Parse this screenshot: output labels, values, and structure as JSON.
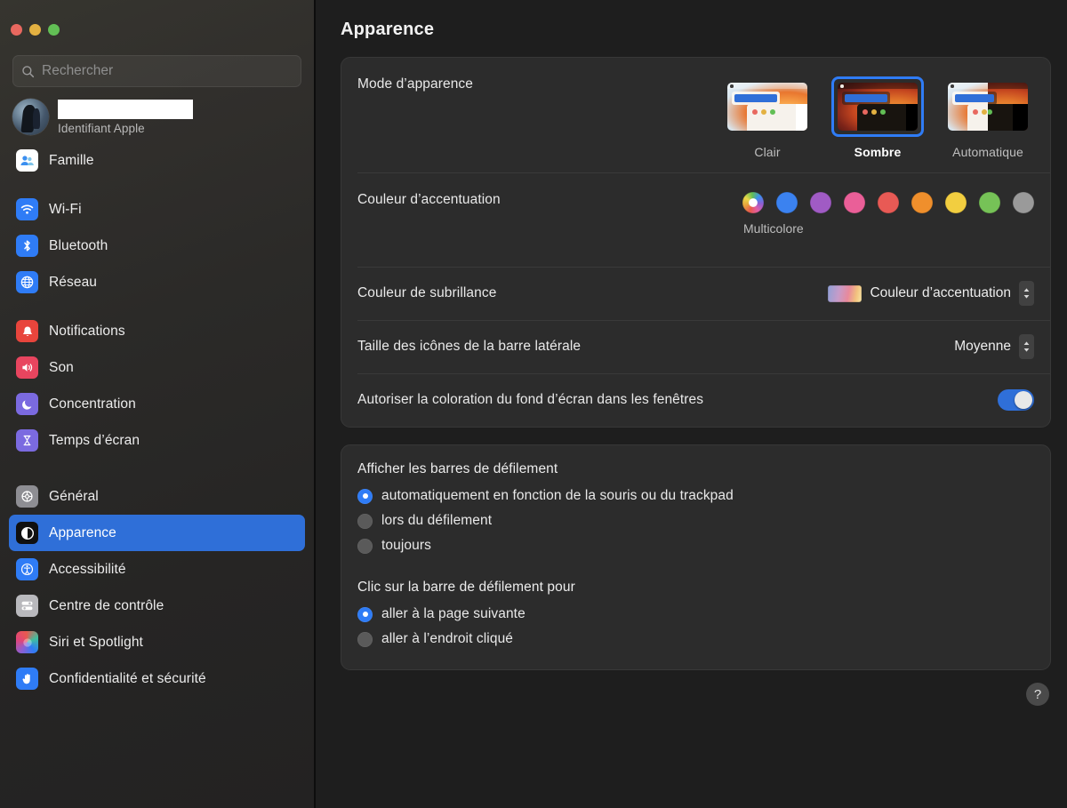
{
  "window": {
    "traffic_lights": [
      {
        "name": "close",
        "color": "#e8685f"
      },
      {
        "name": "minimize",
        "color": "#e3b141"
      },
      {
        "name": "zoom",
        "color": "#62bf55"
      }
    ]
  },
  "sidebar": {
    "search": {
      "placeholder": "Rechercher",
      "value": "",
      "icon": "search-icon"
    },
    "account": {
      "name_redacted": "",
      "subtitle": "Identifiant Apple",
      "avatar": "user-avatar"
    },
    "groups": [
      {
        "items": [
          {
            "label": "Famille",
            "icon": "family-icon",
            "color": "#ffffff",
            "selected": false
          }
        ]
      },
      {
        "items": [
          {
            "label": "Wi-Fi",
            "icon": "wifi-icon",
            "color": "#2f7cf6",
            "selected": false
          },
          {
            "label": "Bluetooth",
            "icon": "bluetooth-icon",
            "color": "#2f7cf6",
            "selected": false
          },
          {
            "label": "Réseau",
            "icon": "network-globe-icon",
            "color": "#2f7cf6",
            "selected": false
          }
        ]
      },
      {
        "items": [
          {
            "label": "Notifications",
            "icon": "notifications-bell-icon",
            "color": "#e8453c",
            "selected": false
          },
          {
            "label": "Son",
            "icon": "sound-speaker-icon",
            "color": "#e8455f",
            "selected": false
          },
          {
            "label": "Concentration",
            "icon": "focus-moon-icon",
            "color": "#7b6ae0",
            "selected": false
          },
          {
            "label": "Temps d’écran",
            "icon": "screen-time-hourglass-icon",
            "color": "#7b6ae0",
            "selected": false
          }
        ]
      },
      {
        "items": [
          {
            "label": "Général",
            "icon": "general-gear-icon",
            "color": "#8e8e93",
            "selected": false
          },
          {
            "label": "Apparence",
            "icon": "appearance-contrast-icon",
            "color": "#1c1c1e",
            "selected": true
          },
          {
            "label": "Accessibilité",
            "icon": "accessibility-icon",
            "color": "#2f7cf6",
            "selected": false
          },
          {
            "label": "Centre de contrôle",
            "icon": "control-center-icon",
            "color": "#8e8e93",
            "selected": false
          },
          {
            "label": "Siri et Spotlight",
            "icon": "siri-icon",
            "color": "#5a5a5a",
            "selected": false
          },
          {
            "label": "Confidentialité et sécurité",
            "icon": "privacy-hand-icon",
            "color": "#2f7cf6",
            "selected": false
          }
        ]
      }
    ]
  },
  "main": {
    "title": "Apparence",
    "appearance_mode": {
      "label": "Mode d’apparence",
      "selected": "Sombre",
      "options": [
        {
          "caption": "Clair",
          "value": "light",
          "selected": false
        },
        {
          "caption": "Sombre",
          "value": "dark",
          "selected": true
        },
        {
          "caption": "Automatique",
          "value": "auto",
          "selected": false
        }
      ]
    },
    "accent_color": {
      "label": "Couleur d’accentuation",
      "caption": "Multicolore",
      "selected": "Multicolore",
      "swatches": [
        {
          "name": "multicolore",
          "color": "multicolor",
          "selected": true
        },
        {
          "name": "bleu",
          "color": "#3b82f0"
        },
        {
          "name": "violet",
          "color": "#a05bc4"
        },
        {
          "name": "rose",
          "color": "#ea5f98"
        },
        {
          "name": "rouge",
          "color": "#e85a55"
        },
        {
          "name": "orange",
          "color": "#ef8f2c"
        },
        {
          "name": "jaune",
          "color": "#f2ce40"
        },
        {
          "name": "vert",
          "color": "#76c257"
        },
        {
          "name": "graphite",
          "color": "#9a9a9a"
        }
      ]
    },
    "highlight_color": {
      "label": "Couleur de subrillance",
      "value": "Couleur d’accentuation"
    },
    "sidebar_icon_size": {
      "label": "Taille des icônes de la barre latérale",
      "value": "Moyenne"
    },
    "wallpaper_tinting": {
      "label": "Autoriser la coloration du fond d’écran dans les fenêtres",
      "enabled": true
    },
    "scrollbars": {
      "title": "Afficher les barres de défilement",
      "options": [
        {
          "label": "automatiquement en fonction de la souris ou du trackpad",
          "selected": true
        },
        {
          "label": "lors du défilement",
          "selected": false
        },
        {
          "label": "toujours",
          "selected": false
        }
      ]
    },
    "scrollbar_click": {
      "title": "Clic sur la barre de défilement pour",
      "options": [
        {
          "label": "aller à la page suivante",
          "selected": true
        },
        {
          "label": "aller à l’endroit cliqué",
          "selected": false
        }
      ]
    },
    "help_button": {
      "label": "?"
    }
  },
  "colors": {
    "accent": "#2f6fd8",
    "selection": "#2f7cf6",
    "card_bg": "#2c2c2c",
    "content_bg": "#1e1e1e"
  }
}
